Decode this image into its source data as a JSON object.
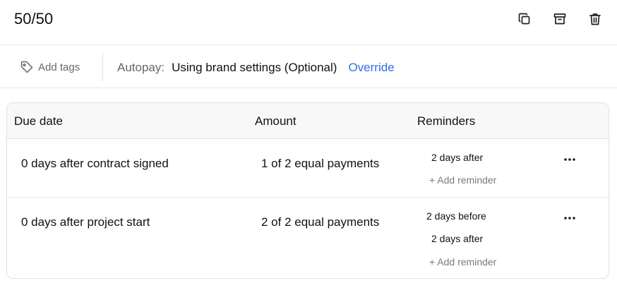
{
  "header": {
    "title": "50/50",
    "actions": {
      "duplicate_icon": "copy-icon",
      "archive_icon": "archive-icon",
      "delete_icon": "trash-icon"
    }
  },
  "meta": {
    "tags_label": "Add tags",
    "autopay_label": "Autopay:",
    "autopay_value": "Using brand settings (Optional)",
    "override_label": "Override"
  },
  "table": {
    "columns": [
      "Due date",
      "Amount",
      "Reminders"
    ],
    "rows": [
      {
        "due_date": "0 days after contract signed",
        "amount": "1 of 2 equal payments",
        "reminders": [
          "2 days after"
        ],
        "add_reminder": "+ Add reminder"
      },
      {
        "due_date": "0 days after project start",
        "amount": "2 of 2 equal payments",
        "reminders": [
          "2 days before",
          "2 days after"
        ],
        "add_reminder": "+ Add reminder"
      }
    ]
  },
  "colors": {
    "link": "#2f6fde",
    "muted": "#666666",
    "border": "#e2e2e2",
    "header_bg": "#f8f8f8"
  }
}
